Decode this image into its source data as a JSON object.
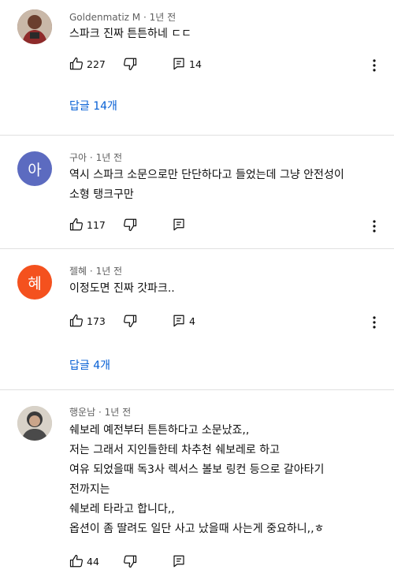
{
  "comments": [
    {
      "author": "Goldenmatiz M",
      "time": "1년 전",
      "lines": [
        "스파크 진짜 튼튼하네 ㄷㄷ"
      ],
      "likes": "227",
      "replies_count": "14",
      "replies_label": "답글 14개",
      "avatar_kind": "photo"
    },
    {
      "author": "구아",
      "time": "1년 전",
      "lines": [
        "역시 스파크 소문으로만 단단하다고 들었는데 그냥 안전성이",
        "소형 탱크구만"
      ],
      "likes": "117",
      "avatar_kind": "letter",
      "avatar_letter": "아",
      "avatar_color": "#5c6bc0"
    },
    {
      "author": "젤혜",
      "time": "1년 전",
      "lines": [
        "이정도면 진짜 갓파크.."
      ],
      "likes": "173",
      "replies_count": "4",
      "replies_label": "답글 4개",
      "avatar_kind": "letter",
      "avatar_letter": "혜",
      "avatar_color": "#f4511e"
    },
    {
      "author": "행운남",
      "time": "1년 전",
      "lines": [
        "쉐보레 예전부터 튼튼하다고 소문났죠,,",
        "저는 그래서 지인들한테 차추천 쉐보레로 하고",
        "여유 되었을때 독3사 렉서스 볼보 링컨 등으로 갈아타기",
        "전까지는",
        "쉐보레 타라고 합니다,,",
        "옵션이 좀 딸려도 일단 사고 났을때 사는게 중요하니,,ㅎ"
      ],
      "likes": "44",
      "avatar_kind": "photo"
    }
  ],
  "icons": {
    "like": "thumbs-up-icon",
    "dislike": "thumbs-down-icon",
    "reply": "comment-icon",
    "more": "more-vert-icon"
  },
  "colors": {
    "reply_link": "#065fd4",
    "meta_text": "#606060",
    "divider": "#e0e0e0"
  }
}
